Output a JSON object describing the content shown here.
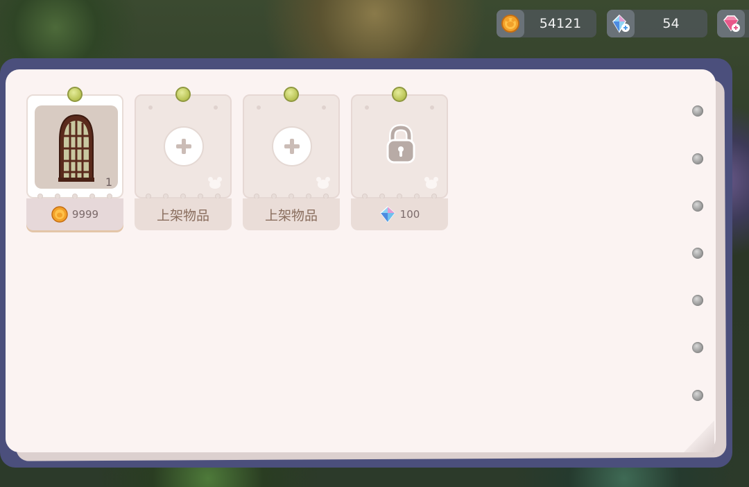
{
  "currency": {
    "coin": {
      "icon": "coin-icon",
      "value": "54121"
    },
    "crystal": {
      "icon": "crystal-plus-icon",
      "value": "54"
    },
    "gem": {
      "icon": "gem-plus-icon"
    }
  },
  "shop_slots": [
    {
      "state": "listed",
      "item_icon": "arched-window-icon",
      "count": "1",
      "price_icon": "coin-icon",
      "price": "9999"
    },
    {
      "state": "empty",
      "label": "上架物品",
      "button_icon": "plus-icon"
    },
    {
      "state": "empty",
      "label": "上架物品",
      "button_icon": "plus-icon"
    },
    {
      "state": "locked",
      "lock_icon": "lock-icon",
      "unlock_cost_icon": "crystal-icon",
      "unlock_cost": "100"
    }
  ],
  "colors": {
    "panel_border": "#4b4f7c",
    "paper": "#fbf3f2",
    "pin": "#c8d06a",
    "tag": "#eaddd8"
  }
}
